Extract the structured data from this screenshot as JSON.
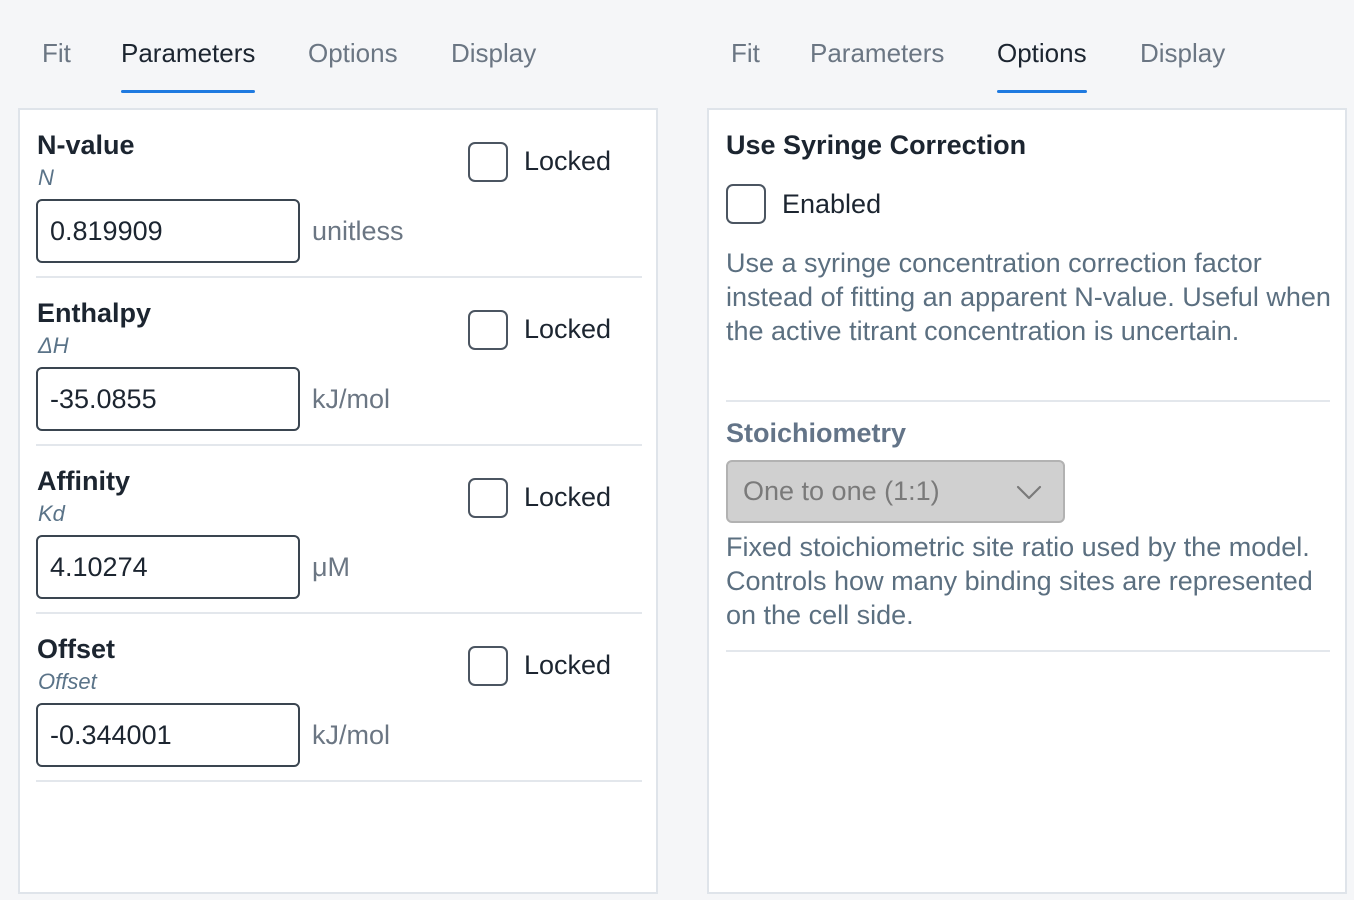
{
  "left": {
    "tabs": [
      {
        "label": "Fit",
        "active": false
      },
      {
        "label": "Parameters",
        "active": true
      },
      {
        "label": "Options",
        "active": false
      },
      {
        "label": "Display",
        "active": false
      }
    ],
    "params": [
      {
        "name": "N-value",
        "symbol": "N",
        "value": "0.819909",
        "unit": "unitless",
        "lock_label": "Locked",
        "locked": false
      },
      {
        "name": "Enthalpy",
        "symbol": "ΔH",
        "value": "-35.0855",
        "unit": "kJ/mol",
        "lock_label": "Locked",
        "locked": false
      },
      {
        "name": "Affinity",
        "symbol": "Kd",
        "value": "4.10274",
        "unit": "μM",
        "lock_label": "Locked",
        "locked": false
      },
      {
        "name": "Offset",
        "symbol": "Offset",
        "value": "-0.344001",
        "unit": "kJ/mol",
        "lock_label": "Locked",
        "locked": false
      }
    ]
  },
  "right": {
    "tabs": [
      {
        "label": "Fit",
        "active": false
      },
      {
        "label": "Parameters",
        "active": false
      },
      {
        "label": "Options",
        "active": true
      },
      {
        "label": "Display",
        "active": false
      }
    ],
    "syringe": {
      "title": "Use Syringe Correction",
      "checkbox_label": "Enabled",
      "enabled": false,
      "description": "Use a syringe concentration correction factor instead of fitting an apparent N-value. Useful when the active titrant concentration is uncertain."
    },
    "stoichiometry": {
      "title": "Stoichiometry",
      "selected": "One to one (1:1)",
      "disabled": true,
      "description": "Fixed stoichiometric site ratio used by the model. Controls how many binding sites are represented on the cell side."
    }
  },
  "icons": {
    "dropdown": "chevron-down-icon"
  },
  "colors": {
    "accent": "#1f7ae0",
    "text": "#1c2530",
    "muted": "#6b7683",
    "symbol": "#5a7388"
  }
}
